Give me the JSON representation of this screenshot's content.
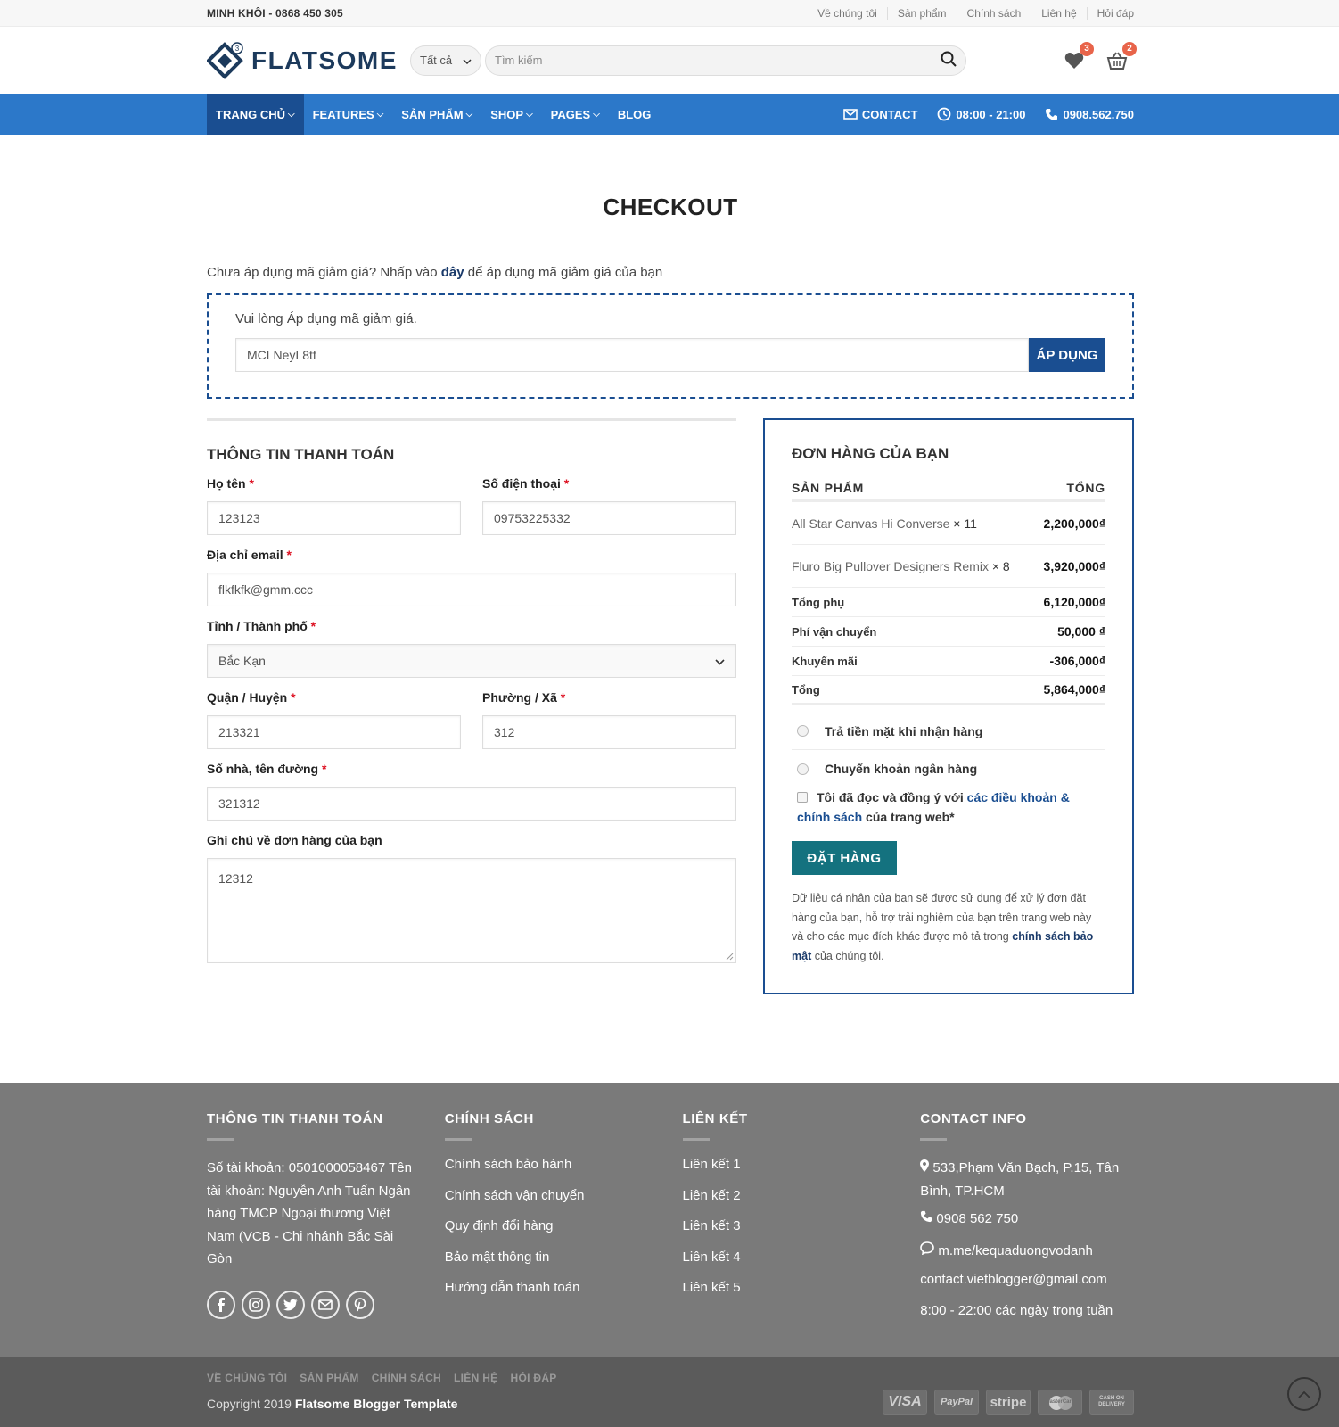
{
  "topbar": {
    "brandline": "MINH KHÔI - 0868 450 305",
    "links": [
      "Về chúng tôi",
      "Sản phẩm",
      "Chính sách",
      "Liên hệ",
      "Hỏi đáp"
    ]
  },
  "header": {
    "logo_text": "FLATSOME",
    "category_select": "Tất cả",
    "search_placeholder": "Tìm kiếm",
    "wishlist_count": "3",
    "cart_count": "2"
  },
  "nav": {
    "items": [
      "TRANG CHỦ",
      "FEATURES",
      "SẢN PHẨM",
      "SHOP",
      "PAGES",
      "BLOG"
    ],
    "contact": "CONTACT",
    "hours": "08:00 - 21:00",
    "phone": "0908.562.750"
  },
  "page": {
    "title": "CHECKOUT",
    "coupon_prompt_before": "Chưa áp dụng mã giảm giá? Nhấp vào",
    "coupon_prompt_link": "đây",
    "coupon_prompt_after": "để áp dụng mã giảm giá của bạn",
    "coupon_label": "Vui lòng Áp dụng mã giảm giá.",
    "coupon_value": "MCLNeyL8tf",
    "coupon_button": "ÁP DỤNG"
  },
  "billing": {
    "title": "THÔNG TIN THANH TOÁN",
    "name_label": "Họ tên",
    "name_value": "123123",
    "phone_label": "Số điện thoại",
    "phone_value": "09753225332",
    "email_label": "Địa chỉ email",
    "email_value": "flkfkfk@gmm.ccc",
    "city_label": "Tỉnh / Thành phố",
    "city_value": "Bắc Kạn",
    "district_label": "Quận / Huyện",
    "district_value": "213321",
    "ward_label": "Phường / Xã",
    "ward_value": "312",
    "street_label": "Số nhà, tên đường",
    "street_value": "321312",
    "notes_label": "Ghi chú về đơn hàng của bạn",
    "notes_value": "12312",
    "required_mark": "*"
  },
  "order": {
    "title": "ĐƠN HÀNG CỦA BẠN",
    "col_product": "SẢN PHẨM",
    "col_total": "TỔNG",
    "items": [
      {
        "name": "All Star Canvas Hi Converse",
        "qty": "× 11",
        "total": "2,200,000₫"
      },
      {
        "name": "Fluro Big Pullover Designers Remix",
        "qty": "× 8",
        "total": "3,920,000₫"
      }
    ],
    "subtotal_label": "Tổng phụ",
    "subtotal_value": "6,120,000₫",
    "shipping_label": "Phí vận chuyển",
    "shipping_value": "50,000 ₫",
    "discount_label": "Khuyến mãi",
    "discount_value": "-306,000₫",
    "total_label": "Tổng",
    "total_value": "5,864,000₫",
    "pay_cod": "Trả tiền mặt khi nhận hàng",
    "pay_bank": "Chuyển khoản ngân hàng",
    "terms_before": "Tôi đã đọc và đồng ý với",
    "terms_link": "các điều khoản & chính sách",
    "terms_after": "của trang web",
    "terms_required": "*",
    "place_order": "ĐẶT HÀNG",
    "privacy_before": "Dữ liệu cá nhân của bạn sẽ được sử dụng để xử lý đơn đặt hàng của bạn, hỗ trợ trải nghiệm của bạn trên trang web này và cho các mục đích khác được mô tả trong",
    "privacy_link": "chính sách bảo mật",
    "privacy_after": "của chúng tôi."
  },
  "footer": {
    "col1_title": "THÔNG TIN THANH TOÁN",
    "col1_text": "Số tài khoản: 0501000058467 Tên tài khoản: Nguyễn Anh Tuấn Ngân hàng TMCP Ngoại thương Việt Nam (VCB - Chi nhánh Bắc Sài Gòn",
    "col2_title": "CHÍNH SÁCH",
    "col2_items": [
      "Chính sách bảo hành",
      "Chính sách vận chuyển",
      "Quy định đổi hàng",
      "Bảo mật thông tin",
      "Hướng dẫn thanh toán"
    ],
    "col3_title": "LIÊN KẾT",
    "col3_items": [
      "Liên kết 1",
      "Liên kết 2",
      "Liên kết 3",
      "Liên kết 4",
      "Liên kết 5"
    ],
    "col4_title": "CONTACT INFO",
    "address": "533,Phạm Văn Bạch, P.15, Tân Bình, TP.HCM",
    "phone": "0908 562 750",
    "messenger": "m.me/kequaduongvodanh",
    "email": "contact.vietblogger@gmail.com",
    "hours": "8:00 - 22:00 các ngày trong tuần"
  },
  "bottombar": {
    "links": [
      "VỀ CHÚNG TÔI",
      "SẢN PHẨM",
      "CHÍNH SÁCH",
      "LIÊN HỆ",
      "HỎI ĐÁP"
    ],
    "copyright_before": "Copyright 2019",
    "copyright_bold": "Flatsome Blogger Template",
    "payments": [
      "VISA",
      "PayPal",
      "stripe",
      "MasterCard",
      "CASH ON DELIVERY"
    ]
  },
  "colors": {
    "nav_blue": "#2c78c9",
    "nav_active": "#1a4e91",
    "order_button": "#14727f",
    "footer": "#7a7a7a",
    "badge": "#e8644a"
  }
}
